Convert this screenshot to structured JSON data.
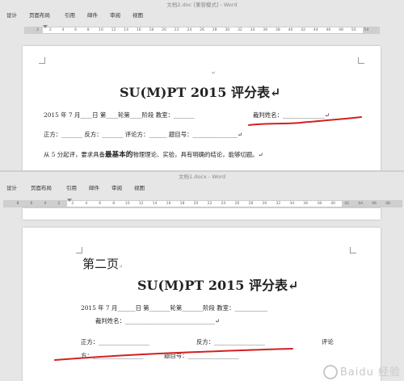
{
  "top_window": {
    "title": "文档2.doc [兼容模式] - Word",
    "tabs": [
      "设计",
      "页面布局",
      "引用",
      "邮件",
      "审阅",
      "视图"
    ],
    "ruler_ticks": [
      "2",
      "2",
      "4",
      "6",
      "8",
      "10",
      "12",
      "14",
      "16",
      "18",
      "20",
      "22",
      "24",
      "26",
      "28",
      "30",
      "32",
      "34",
      "36",
      "38",
      "40",
      "42",
      "44",
      "46",
      "48",
      "50",
      "54"
    ],
    "doc": {
      "para_mark": "↵",
      "heading": "SU(M)PT 2015 评分表↵",
      "row1_left": "2015 年 7 月____日  第____轮第____阶段   教室：_______",
      "row1_right": "裁判姓名：______________↵",
      "row2": "正方：_______     反方：_______     评论方：______     题目号：_______________↵",
      "row3_pre": "从 5 分起评，要求具备",
      "row3_bold": "最基本的",
      "row3_post": "物理理论、实验，具有明确的结论，能够切题。↵"
    }
  },
  "bottom_window": {
    "title": "文档1.docx - Word",
    "tabs": [
      "设计",
      "页面布局",
      "引用",
      "邮件",
      "审阅",
      "视图"
    ],
    "ruler_ticks": [
      "8",
      "6",
      "4",
      "2",
      "2",
      "4",
      "6",
      "8",
      "10",
      "12",
      "14",
      "16",
      "18",
      "20",
      "22",
      "24",
      "26",
      "28",
      "30",
      "32",
      "34",
      "36",
      "38",
      "40",
      "42",
      "44",
      "46",
      "48"
    ],
    "doc": {
      "page_label": "第二页",
      "page_label_mark": "↵",
      "heading": "SU(M)PT 2015  评分表↵",
      "row1": "2015 年 7 月______日     第_______轮第_______阶段     教室：___________",
      "row2": "裁判姓名：______________________________↵",
      "row3_left": "正方：_________________",
      "row3_right": "反方：_________________",
      "row3_far": "评论",
      "row4_left": "方：_________________",
      "row4_right": "题目号：_________________"
    }
  },
  "watermark": "Baidu 经验",
  "annotation_color": "#d42020"
}
